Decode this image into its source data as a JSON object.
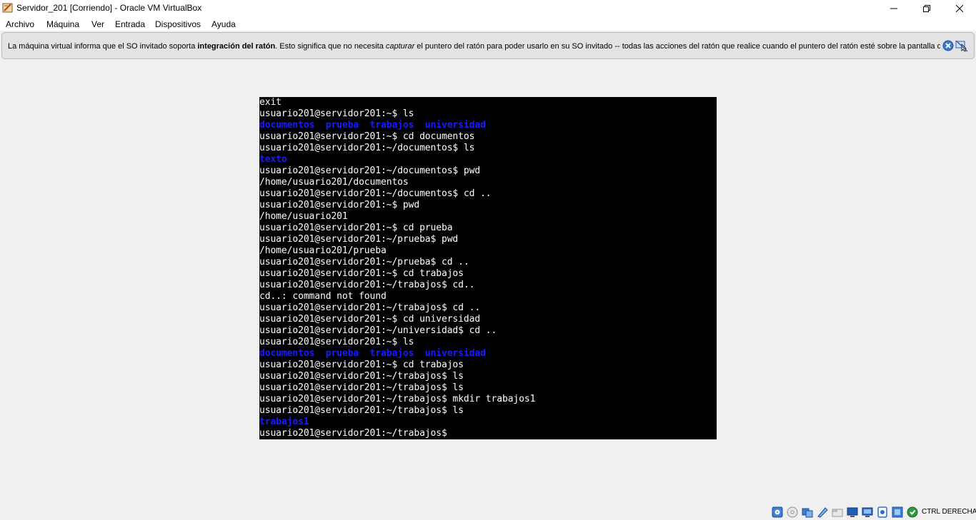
{
  "window": {
    "title": "Servidor_201 [Corriendo] - Oracle VM VirtualBox",
    "app_icon": "virtualbox-icon",
    "controls": [
      "minimize-icon",
      "maximize-icon",
      "close-icon"
    ]
  },
  "menu": {
    "items": [
      "Archivo",
      "Máquina",
      "Ver",
      "Entrada",
      "Dispositivos",
      "Ayuda"
    ]
  },
  "notification": {
    "text_before": "La máquina virtual informa que el SO invitado soporta ",
    "text_bold": "integración del ratón",
    "text_middle": ". Esto significa que no necesita ",
    "text_italic": "capturar",
    "text_after": " el puntero del ratón para poder usarlo en su SO invitado -- todas las acciones del ratón que realice cuando el puntero del ratón esté sobre la pantalla de",
    "icons": [
      "close-notice-icon",
      "mouse-integration-icon"
    ]
  },
  "console": {
    "lines": [
      {
        "text": "exit",
        "color": "white"
      },
      {
        "text": "usuario201@servidor201:~$ ls",
        "color": "white"
      },
      {
        "text": "documentos  prueba  trabajos  universidad",
        "color": "blue"
      },
      {
        "text": "usuario201@servidor201:~$ cd documentos",
        "color": "white"
      },
      {
        "text": "usuario201@servidor201:~/documentos$ ls",
        "color": "white"
      },
      {
        "text": "texto",
        "color": "blue"
      },
      {
        "text": "usuario201@servidor201:~/documentos$ pwd",
        "color": "white"
      },
      {
        "text": "/home/usuario201/documentos",
        "color": "white"
      },
      {
        "text": "usuario201@servidor201:~/documentos$ cd ..",
        "color": "white"
      },
      {
        "text": "usuario201@servidor201:~$ pwd",
        "color": "white"
      },
      {
        "text": "/home/usuario201",
        "color": "white"
      },
      {
        "text": "usuario201@servidor201:~$ cd prueba",
        "color": "white"
      },
      {
        "text": "usuario201@servidor201:~/prueba$ pwd",
        "color": "white"
      },
      {
        "text": "/home/usuario201/prueba",
        "color": "white"
      },
      {
        "text": "usuario201@servidor201:~/prueba$ cd ..",
        "color": "white"
      },
      {
        "text": "usuario201@servidor201:~$ cd trabajos",
        "color": "white"
      },
      {
        "text": "usuario201@servidor201:~/trabajos$ cd..",
        "color": "white"
      },
      {
        "text": "cd..: command not found",
        "color": "white"
      },
      {
        "text": "usuario201@servidor201:~/trabajos$ cd ..",
        "color": "white"
      },
      {
        "text": "usuario201@servidor201:~$ cd universidad",
        "color": "white"
      },
      {
        "text": "usuario201@servidor201:~/universidad$ cd ..",
        "color": "white"
      },
      {
        "text": "usuario201@servidor201:~$ ls",
        "color": "white"
      },
      {
        "text": "documentos  prueba  trabajos  universidad",
        "color": "blue"
      },
      {
        "text": "usuario201@servidor201:~$ cd trabajos",
        "color": "white"
      },
      {
        "text": "usuario201@servidor201:~/trabajos$ ls",
        "color": "white"
      },
      {
        "text": "usuario201@servidor201:~/trabajos$ ls",
        "color": "white"
      },
      {
        "text": "usuario201@servidor201:~/trabajos$ mkdir trabajos1",
        "color": "white"
      },
      {
        "text": "usuario201@servidor201:~/trabajos$ ls",
        "color": "white"
      },
      {
        "text": "trabajos1",
        "color": "blue"
      },
      {
        "text": "usuario201@servidor201:~/trabajos$",
        "color": "white"
      }
    ]
  },
  "statusbar": {
    "icons": [
      "hard-disk-icon",
      "optical-drive-icon",
      "audio-icon",
      "network-icon",
      "usb-icon",
      "shared-folders-icon",
      "display-icon",
      "video-capture-icon",
      "cpu-icon",
      "mouse-integration-status-icon",
      "keyboard-capture-icon"
    ],
    "host_key": "CTRL DERECHA"
  },
  "colors": {
    "console_bg": "#000000",
    "console_fg": "#ffffff",
    "console_dir": "#1a1aff",
    "notice_bg": "#e3e3e3"
  }
}
